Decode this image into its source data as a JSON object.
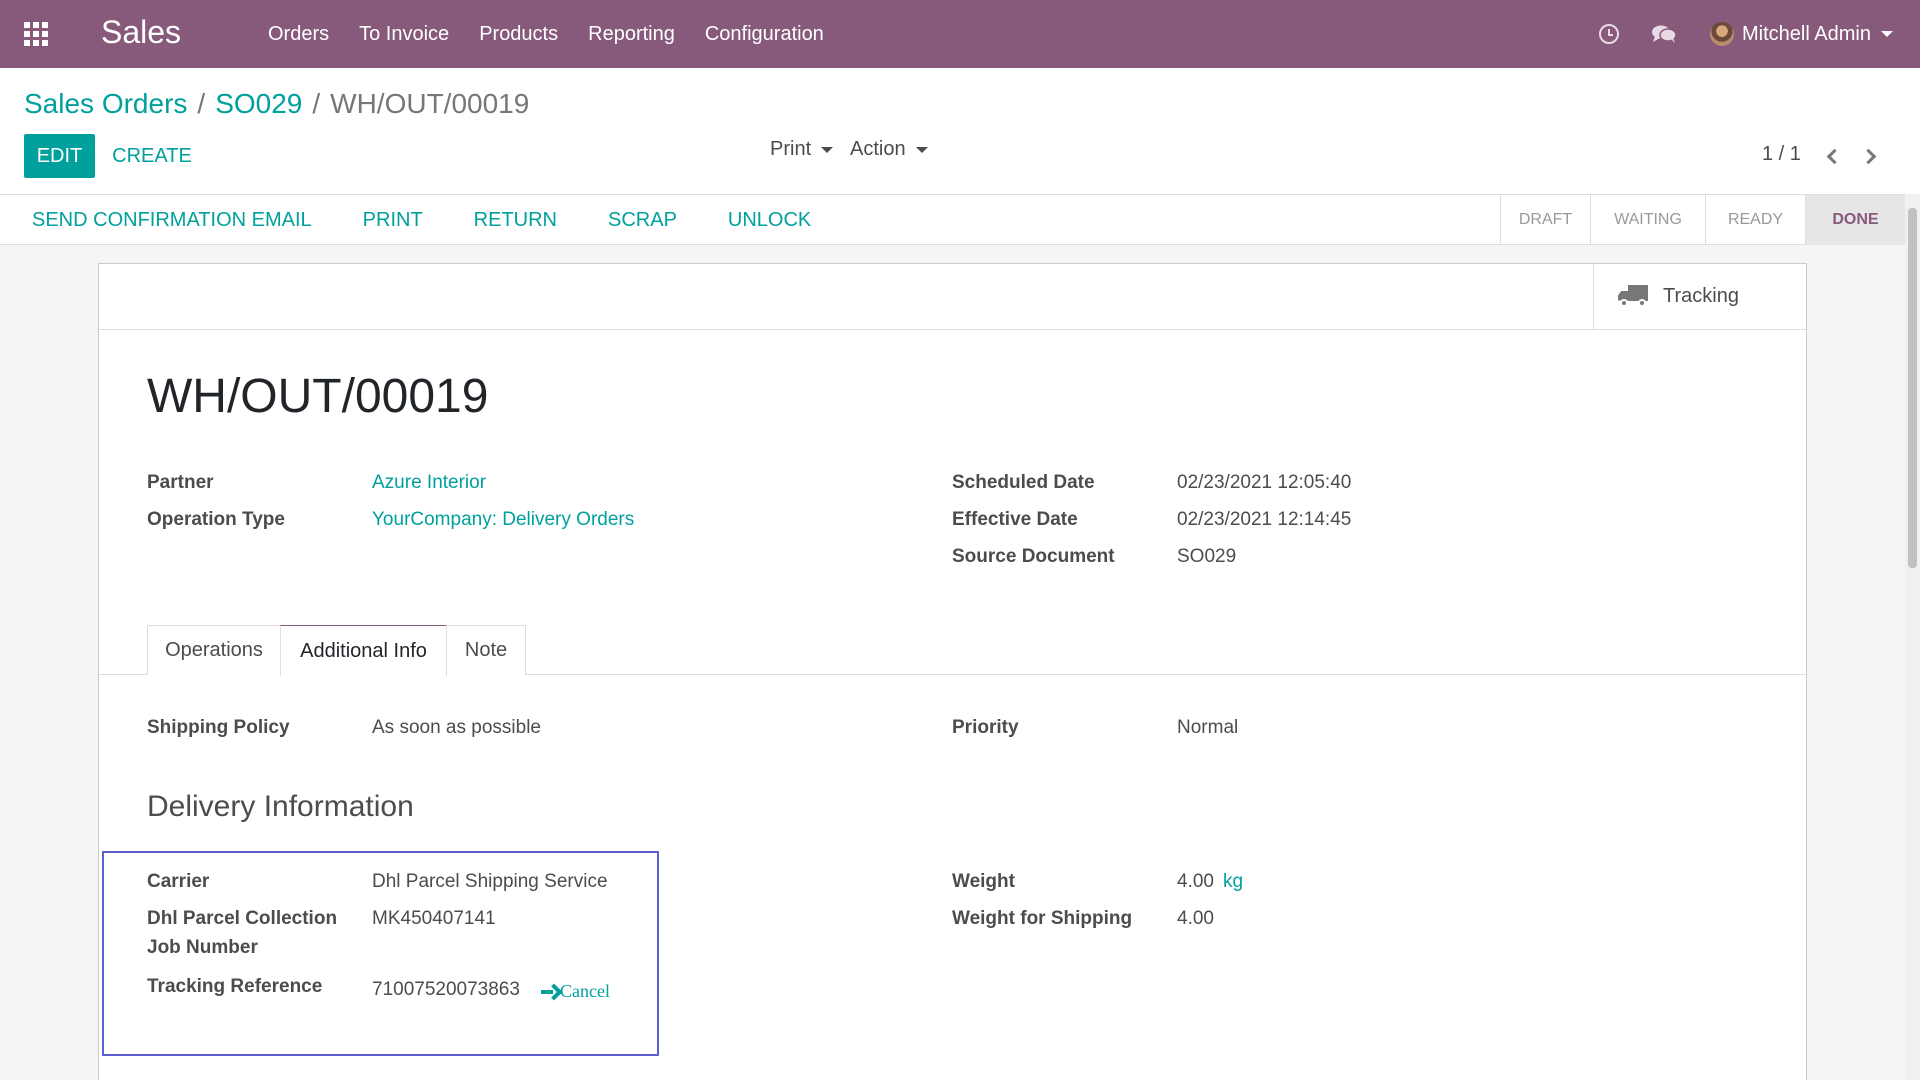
{
  "navbar": {
    "app_name": "Sales",
    "menu": [
      "Orders",
      "To Invoice",
      "Products",
      "Reporting",
      "Configuration"
    ],
    "user_name": "Mitchell Admin",
    "bg_color": "#875a7b"
  },
  "breadcrumb": {
    "level1": "Sales Orders",
    "level2": "SO029",
    "current": "WH/OUT/00019",
    "separator": "/"
  },
  "controls": {
    "edit_label": "EDIT",
    "create_label": "CREATE",
    "print_label": "Print",
    "action_label": "Action",
    "pager": "1 / 1"
  },
  "statusbar": {
    "actions": [
      "SEND CONFIRMATION EMAIL",
      "PRINT",
      "RETURN",
      "SCRAP",
      "UNLOCK"
    ],
    "stages": [
      "DRAFT",
      "WAITING",
      "READY",
      "DONE"
    ],
    "active_stage": "DONE"
  },
  "smart_buttons": {
    "tracking_label": "Tracking"
  },
  "record": {
    "title": "WH/OUT/00019",
    "partner_label": "Partner",
    "partner_value": "Azure Interior",
    "operation_type_label": "Operation Type",
    "operation_type_value": "YourCompany: Delivery Orders",
    "scheduled_date_label": "Scheduled Date",
    "scheduled_date_value": "02/23/2021 12:05:40",
    "effective_date_label": "Effective Date",
    "effective_date_value": "02/23/2021 12:14:45",
    "source_document_label": "Source Document",
    "source_document_value": "SO029"
  },
  "tabs": [
    "Operations",
    "Additional Info",
    "Note"
  ],
  "active_tab": "Additional Info",
  "additional_info": {
    "shipping_policy_label": "Shipping Policy",
    "shipping_policy_value": "As soon as possible",
    "priority_label": "Priority",
    "priority_value": "Normal",
    "section_title": "Delivery Information",
    "carrier_label": "Carrier",
    "carrier_value": "Dhl Parcel Shipping Service",
    "collection_label_line1": "Dhl Parcel Collection",
    "collection_label_line2": "Job Number",
    "collection_value": "MK450407141",
    "tracking_ref_label": "Tracking Reference",
    "tracking_ref_value": "71007520073863",
    "cancel_label": "Cancel",
    "weight_label": "Weight",
    "weight_value": "4.00",
    "weight_unit": "kg",
    "weight_shipping_label": "Weight for Shipping",
    "weight_shipping_value": "4.00"
  },
  "colors": {
    "accent": "#00a09d",
    "brand": "#875a7b",
    "highlight_border": "#5b5fd1"
  }
}
